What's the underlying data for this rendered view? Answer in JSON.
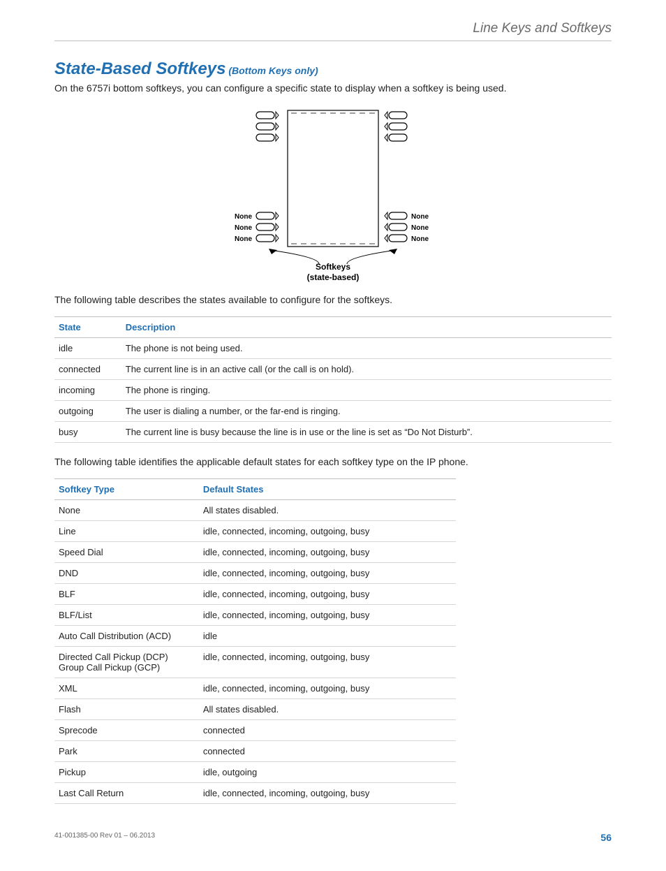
{
  "header": {
    "section": "Line Keys and Softkeys"
  },
  "title": {
    "main": "State-Based Softkeys",
    "sub": " (Bottom Keys only)"
  },
  "intro": "On the 6757i bottom softkeys, you can configure a specific state to display when a softkey is being used.",
  "diagram": {
    "left_labels": [
      "None",
      "None",
      "None"
    ],
    "right_labels": [
      "None",
      "None",
      "None"
    ],
    "caption_line1": "Softkeys",
    "caption_line2": "(state-based)"
  },
  "states_intro": "The following table describes the states available to configure for the softkeys.",
  "states_table": {
    "headers": [
      "State",
      "Description"
    ],
    "rows": [
      [
        "idle",
        "The phone is not being used."
      ],
      [
        "connected",
        "The current line is in an active call (or the call is on hold)."
      ],
      [
        "incoming",
        "The phone is ringing."
      ],
      [
        "outgoing",
        "The user is dialing a number, or the far-end is ringing."
      ],
      [
        "busy",
        "The current line is busy because the line is in use or the line is set as “Do Not Disturb”."
      ]
    ]
  },
  "types_intro": "The following table identifies the applicable default states for each softkey type on the IP phone.",
  "types_table": {
    "headers": [
      "Softkey Type",
      "Default States"
    ],
    "rows": [
      [
        "None",
        "All states disabled."
      ],
      [
        "Line",
        "idle, connected, incoming, outgoing, busy"
      ],
      [
        "Speed Dial",
        "idle, connected, incoming, outgoing, busy"
      ],
      [
        "DND",
        "idle, connected, incoming, outgoing, busy"
      ],
      [
        "BLF",
        "idle, connected, incoming, outgoing, busy"
      ],
      [
        "BLF/List",
        "idle, connected, incoming, outgoing, busy"
      ],
      [
        "Auto Call Distribution (ACD)",
        "idle"
      ],
      [
        "Directed Call Pickup (DCP)\nGroup Call Pickup (GCP)",
        "idle, connected, incoming, outgoing, busy"
      ],
      [
        "XML",
        "idle, connected, incoming, outgoing, busy"
      ],
      [
        "Flash",
        "All states disabled."
      ],
      [
        "Sprecode",
        "connected"
      ],
      [
        "Park",
        "connected"
      ],
      [
        "Pickup",
        "idle, outgoing"
      ],
      [
        "Last Call Return",
        "idle, connected, incoming, outgoing, busy"
      ]
    ]
  },
  "footer": {
    "docid": "41-001385-00 Rev 01 – 06.2013",
    "page": "56"
  }
}
